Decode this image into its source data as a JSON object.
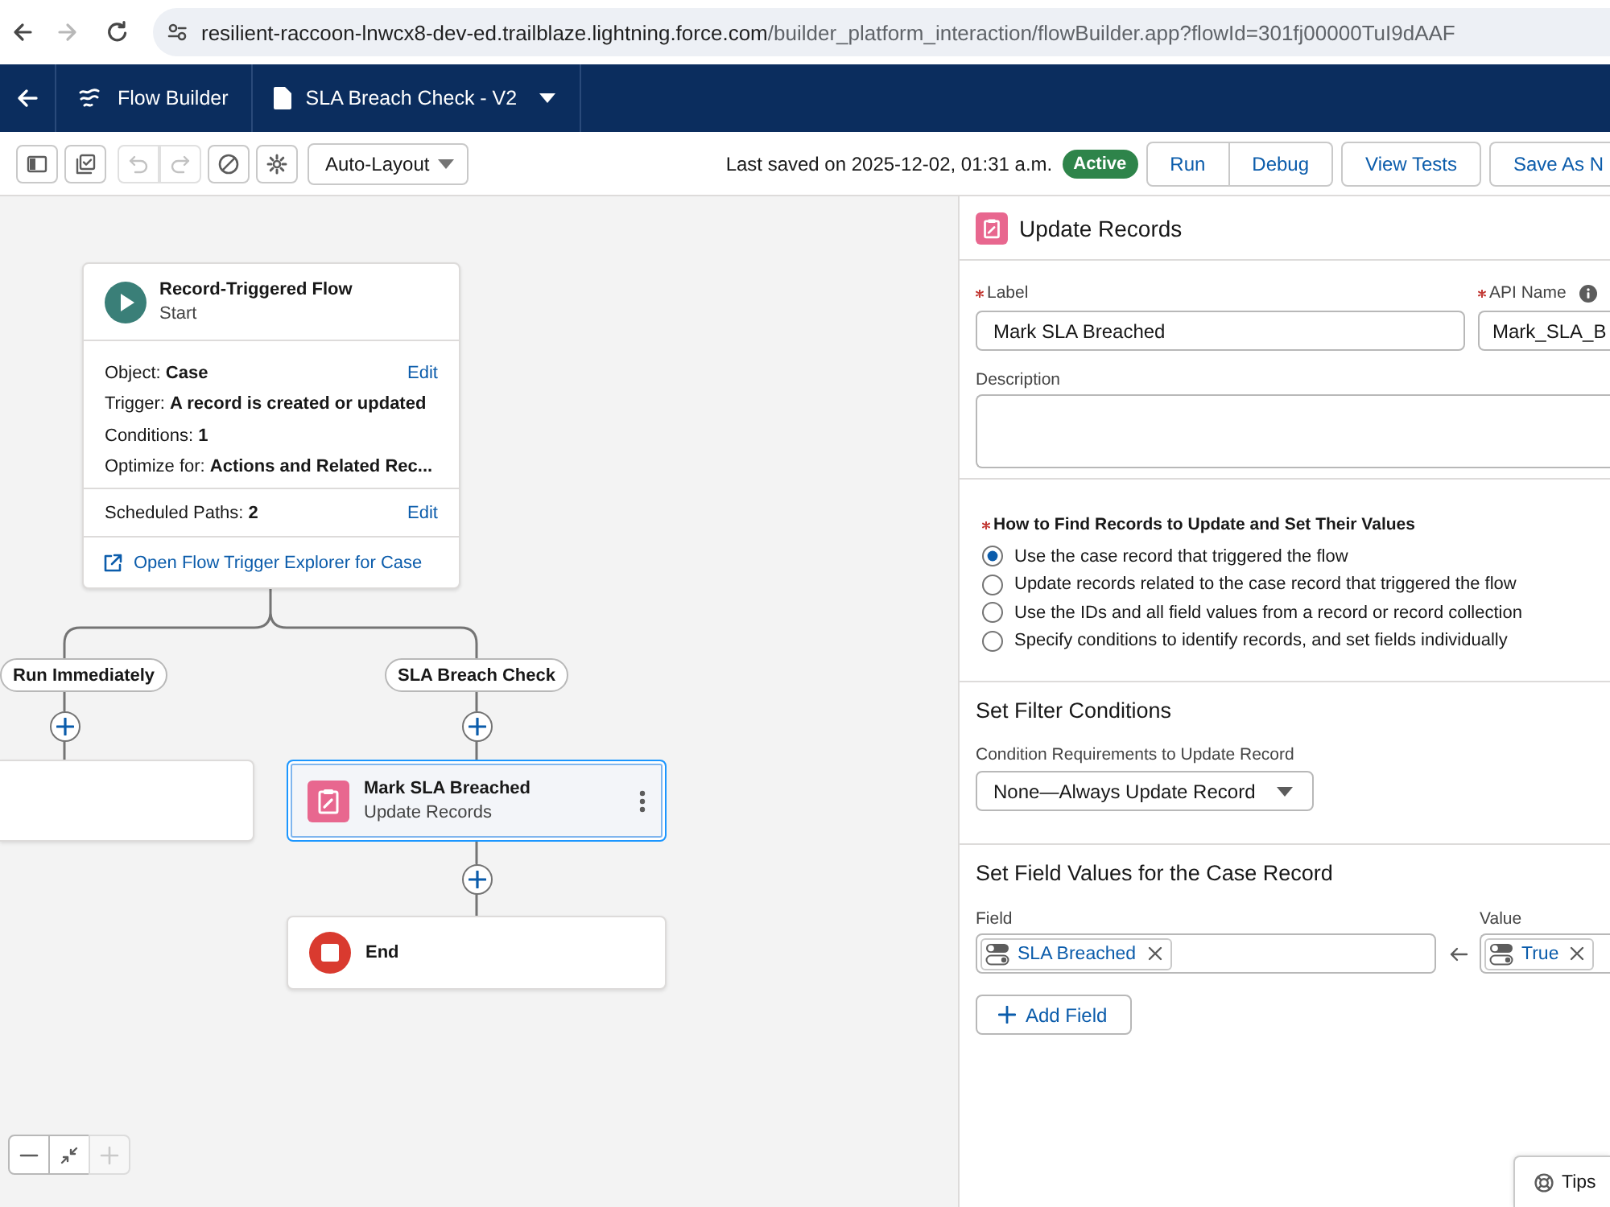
{
  "browser": {
    "nav": [
      {
        "kind": "back",
        "disabled": false
      },
      {
        "kind": "forward",
        "disabled": true
      },
      {
        "kind": "reload",
        "disabled": false
      }
    ],
    "url_host": "resilient-raccoon-lnwcx8-dev-ed.trailblaze.lightning.force.com",
    "url_path": "/builder_platform_interaction/flowBuilder.app?flowId=301fj00000TuI9dAAF"
  },
  "app_bar": {
    "app_name": "Flow Builder",
    "flow_title": "SLA Breach Check - V2"
  },
  "toolbar": {
    "tools": [
      {
        "kind": "panel",
        "disabled": false
      },
      {
        "kind": "checklist",
        "disabled": false
      },
      {
        "kind": "undo",
        "disabled": true
      },
      {
        "kind": "redo",
        "disabled": true
      },
      {
        "kind": "ban",
        "disabled": false
      },
      {
        "kind": "gear",
        "disabled": false
      }
    ],
    "layout_select": "Auto-Layout",
    "last_saved": "Last saved on 2025-12-02, 01:31 a.m.",
    "status": "Active",
    "button_group": [
      "Run",
      "Debug"
    ],
    "buttons": [
      "View Tests",
      "Save As N"
    ]
  },
  "canvas": {
    "start": {
      "title": "Record-Triggered Flow",
      "subtitle": "Start",
      "rows": [
        {
          "text": "Object: **Case**",
          "action": "Edit"
        },
        {
          "text": "Trigger:  **A record is created or updated**"
        },
        {
          "text": "Conditions: **1**"
        },
        {
          "text": "Optimize for: **Actions and Related Rec...**"
        }
      ],
      "scheduled": {
        "text": "Scheduled Paths: **2**",
        "action": "Edit"
      },
      "link": "Open Flow Trigger Explorer for Case"
    },
    "branches": [
      {
        "label": "Run Immediately",
        "nodes": [
          {
            "kind": "blank",
            "selected": false
          }
        ]
      },
      {
        "label": "SLA Breach Check",
        "nodes": [
          {
            "kind": "update",
            "title": "Mark SLA Breached",
            "subtitle": "Update Records",
            "selected": true
          },
          {
            "kind": "end",
            "title": "End",
            "selected": false
          }
        ]
      }
    ],
    "zoom_controls": [
      {
        "kind": "zoom_out",
        "disabled": false
      },
      {
        "kind": "fit",
        "disabled": false
      },
      {
        "kind": "zoom_in",
        "disabled": true
      }
    ]
  },
  "panel": {
    "title": "Update Records",
    "fields": [
      {
        "label": "Label",
        "required": true,
        "info": false,
        "value": "Mark SLA Breached"
      },
      {
        "label": "API Name",
        "required": true,
        "info": true,
        "value": "Mark_SLA_B"
      }
    ],
    "description": {
      "label": "Description"
    },
    "record_choice": {
      "label": "How to Find Records to Update and Set Their Values",
      "required": true,
      "options": [
        {
          "label": "Use the case record that triggered the flow",
          "selected": true
        },
        {
          "label": "Update records related to the case record that triggered the flow",
          "selected": false
        },
        {
          "label": "Use the IDs and all field values from a record or record collection",
          "selected": false
        },
        {
          "label": "Specify conditions to identify records, and set fields individually",
          "selected": false
        }
      ]
    },
    "filter": {
      "heading": "Set Filter Conditions",
      "label": "Condition Requirements to Update Record",
      "value": "None—Always Update Record"
    },
    "assignments": {
      "heading": "Set Field Values for the Case Record",
      "field_label": "Field",
      "value_label": "Value",
      "rows": [
        {
          "field": "SLA Breached",
          "value": "True"
        }
      ],
      "add_button": "Add Field"
    }
  },
  "tips": "Tips"
}
